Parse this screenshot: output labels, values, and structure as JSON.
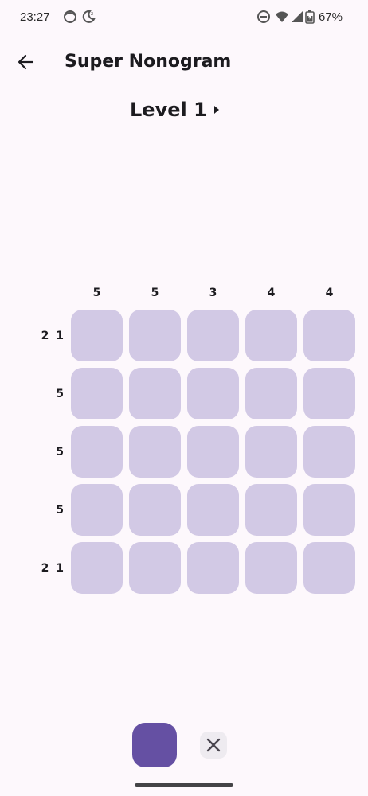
{
  "status_bar": {
    "time": "23:27",
    "battery_percent": "67%",
    "icons": [
      "face-icon",
      "moon-icon",
      "dnd-icon",
      "wifi-icon",
      "signal-icon",
      "battery-icon"
    ]
  },
  "app_bar": {
    "title": "Super Nonogram",
    "back_icon": "arrow-left-icon"
  },
  "level": {
    "title": "Level 1",
    "next_icon": "triangle-right-icon"
  },
  "puzzle": {
    "column_clues": [
      "5",
      "5",
      "3",
      "4",
      "4"
    ],
    "row_clues": [
      "2 1",
      "5",
      "5",
      "5",
      "2 1"
    ],
    "grid_size": 5
  },
  "controls": {
    "fill_mode": "fill-square-icon",
    "cross_mode": "close-icon"
  },
  "colors": {
    "background": "#fdf8fc",
    "cell": "#d2c9e5",
    "accent": "#6550a3",
    "text": "#1c1b1f"
  }
}
